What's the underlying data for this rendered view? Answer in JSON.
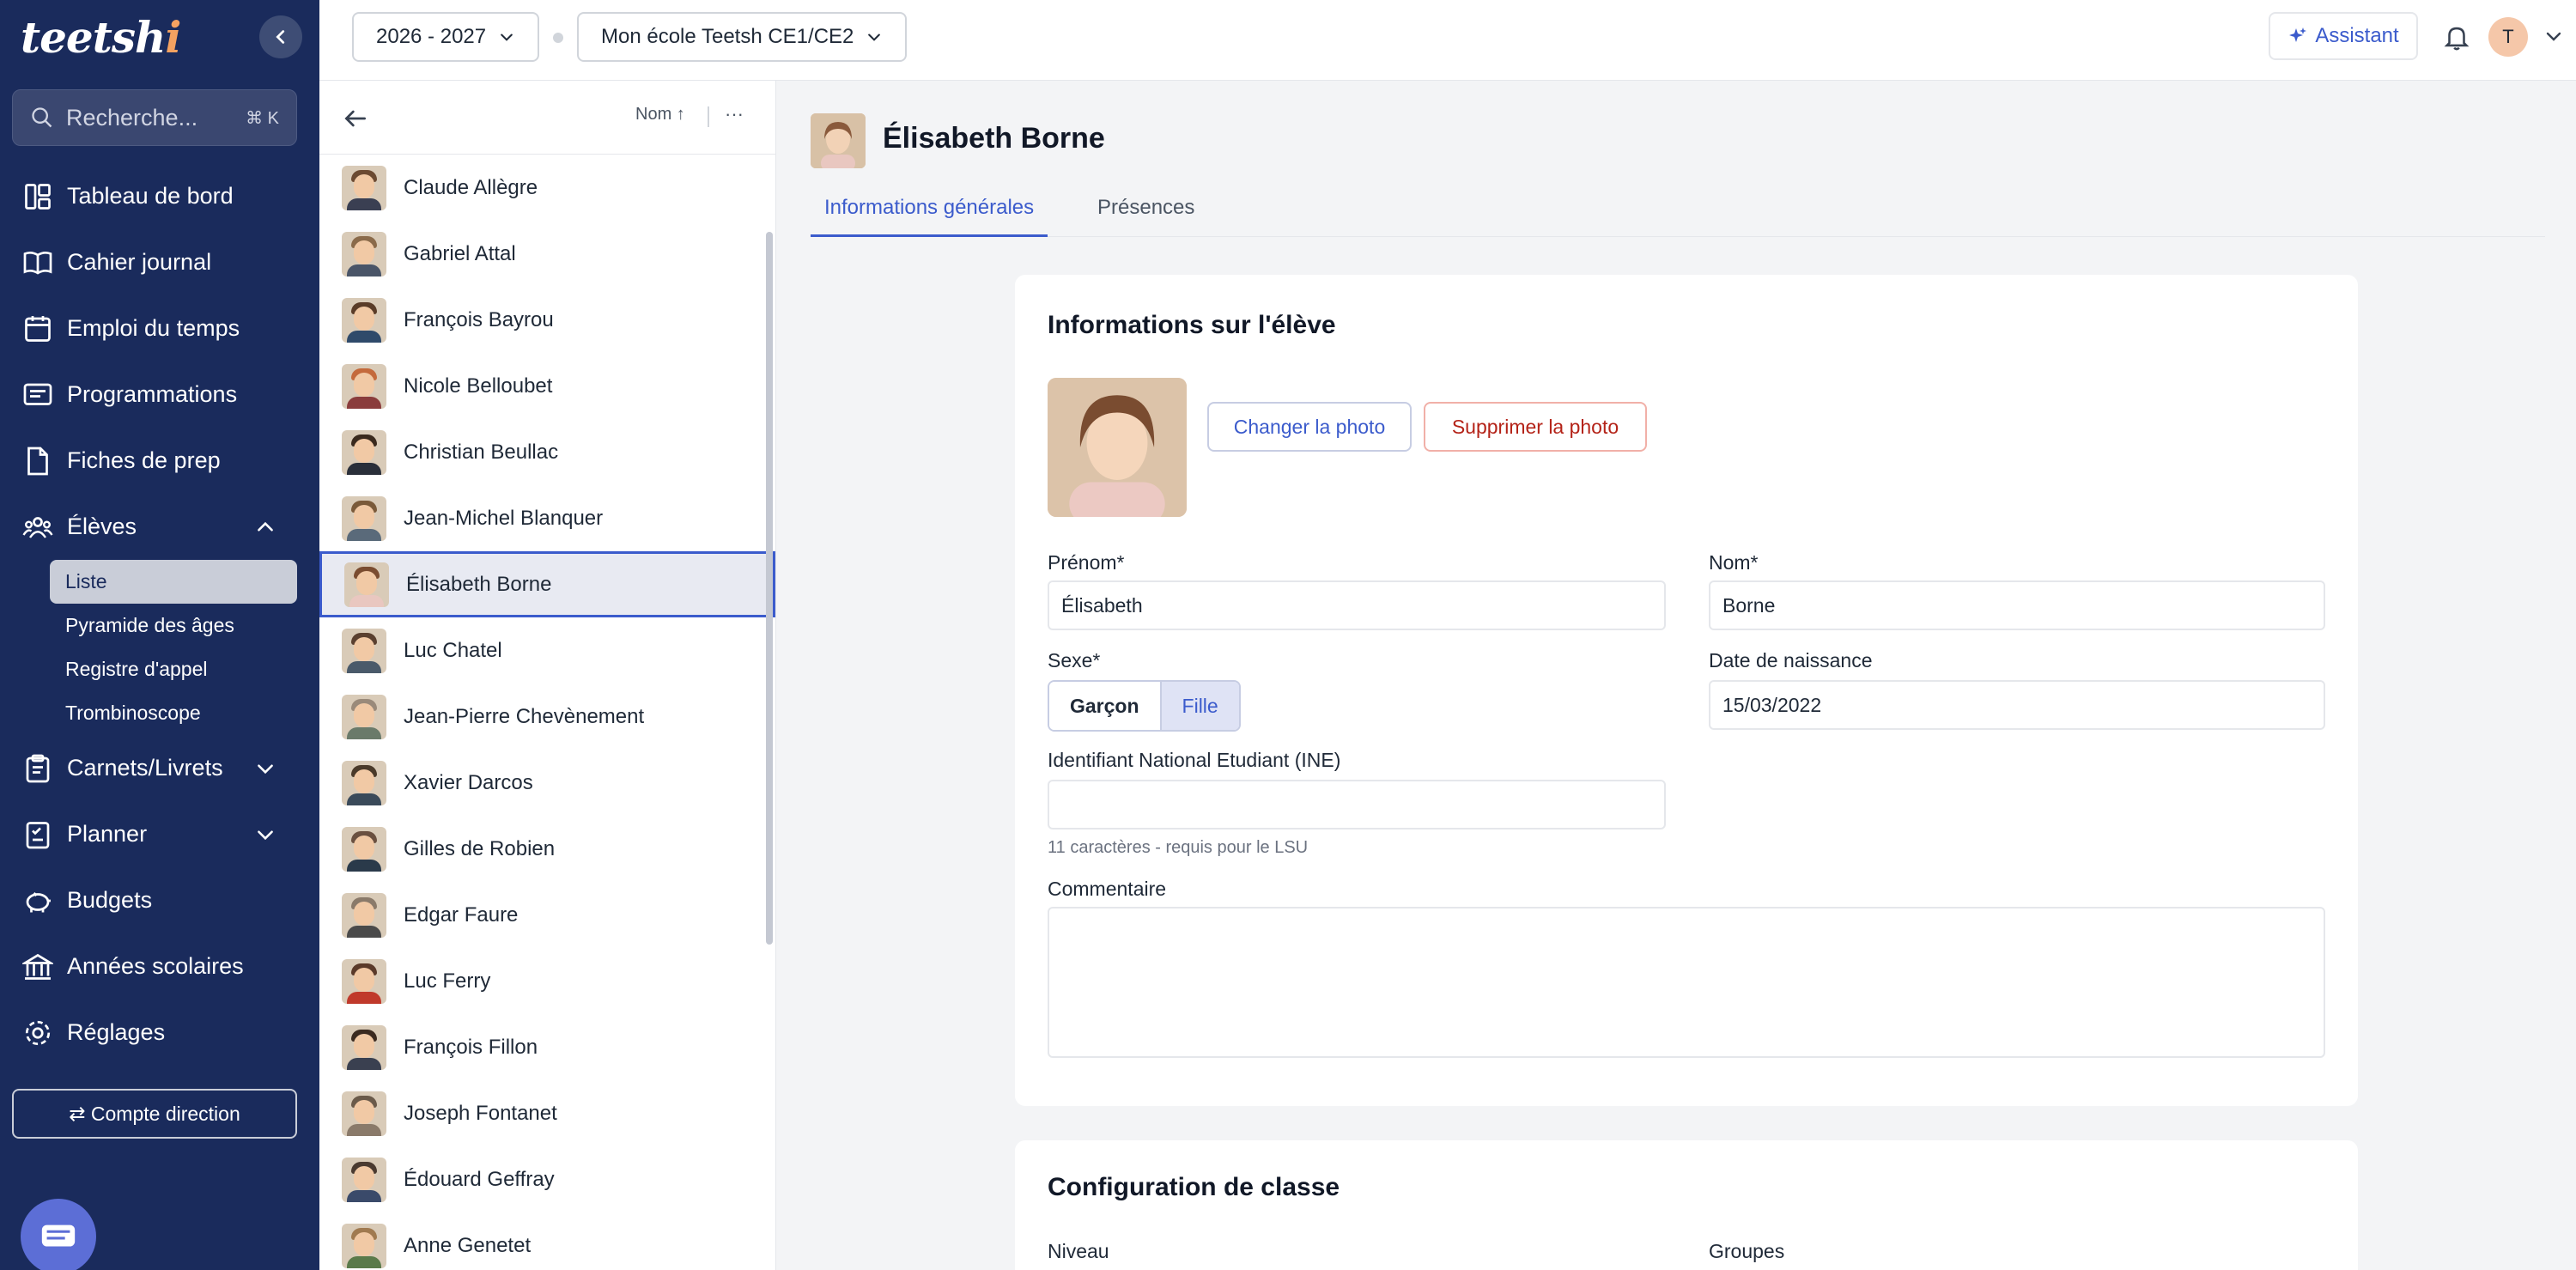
{
  "app": {
    "logo": "teetsh",
    "logo_dot": "i"
  },
  "search": {
    "placeholder": "Recherche...",
    "shortcut": "⌘ K"
  },
  "sidebar": {
    "items": [
      {
        "label": "Tableau de bord",
        "icon": "dashboard-icon"
      },
      {
        "label": "Cahier journal",
        "icon": "book-icon"
      },
      {
        "label": "Emploi du temps",
        "icon": "calendar-icon"
      },
      {
        "label": "Programmations",
        "icon": "presentation-icon"
      },
      {
        "label": "Fiches de prep",
        "icon": "document-icon"
      },
      {
        "label": "Élèves",
        "icon": "users-icon"
      }
    ],
    "sub_items": [
      "Liste",
      "Pyramide des âges",
      "Registre d'appel",
      "Trombinoscope"
    ],
    "items_after": [
      {
        "label": "Carnets/Livrets",
        "icon": "clipboard-icon"
      },
      {
        "label": "Planner",
        "icon": "planner-icon"
      },
      {
        "label": "Budgets",
        "icon": "piggy-bank-icon"
      },
      {
        "label": "Années scolaires",
        "icon": "bank-icon"
      },
      {
        "label": "Réglages",
        "icon": "gear-icon"
      }
    ],
    "compte_button": "⇄ Compte direction"
  },
  "topbar": {
    "year": "2026 - 2027",
    "school": "Mon école Teetsh CE1/CE2",
    "assistant": "Assistant",
    "user_initial": "T"
  },
  "list": {
    "sort_label": "Nom ↑",
    "more": "···",
    "students": [
      "Claude Allègre",
      "Gabriel Attal",
      "François Bayrou",
      "Nicole Belloubet",
      "Christian Beullac",
      "Jean-Michel Blanquer",
      "Élisabeth Borne",
      "Luc Chatel",
      "Jean-Pierre Chevènement",
      "Xavier Darcos",
      "Gilles de Robien",
      "Edgar Faure",
      "Luc Ferry",
      "François Fillon",
      "Joseph Fontanet",
      "Édouard Geffray",
      "Anne Genetet"
    ],
    "selected_index": 6
  },
  "detail": {
    "name": "Élisabeth Borne",
    "tabs": [
      "Informations générales",
      "Présences"
    ],
    "card1": {
      "title": "Informations sur l'élève",
      "change_photo": "Changer la photo",
      "delete_photo": "Supprimer la photo",
      "prenom_label": "Prénom*",
      "prenom_value": "Élisabeth",
      "nom_label": "Nom*",
      "nom_value": "Borne",
      "sexe_label": "Sexe*",
      "sexe_garcon": "Garçon",
      "sexe_fille": "Fille",
      "dob_label": "Date de naissance",
      "dob_value": "15/03/2022",
      "ine_label": "Identifiant National Etudiant (INE)",
      "ine_value": "",
      "ine_hint": "11 caractères - requis pour le LSU",
      "comment_label": "Commentaire"
    },
    "card2": {
      "title": "Configuration de classe",
      "niveau_label": "Niveau",
      "groupes_label": "Groupes"
    }
  },
  "colors": {
    "sidebar_bg": "#1a2b5c",
    "accent": "#3b5bcc",
    "danger": "#b42318"
  }
}
